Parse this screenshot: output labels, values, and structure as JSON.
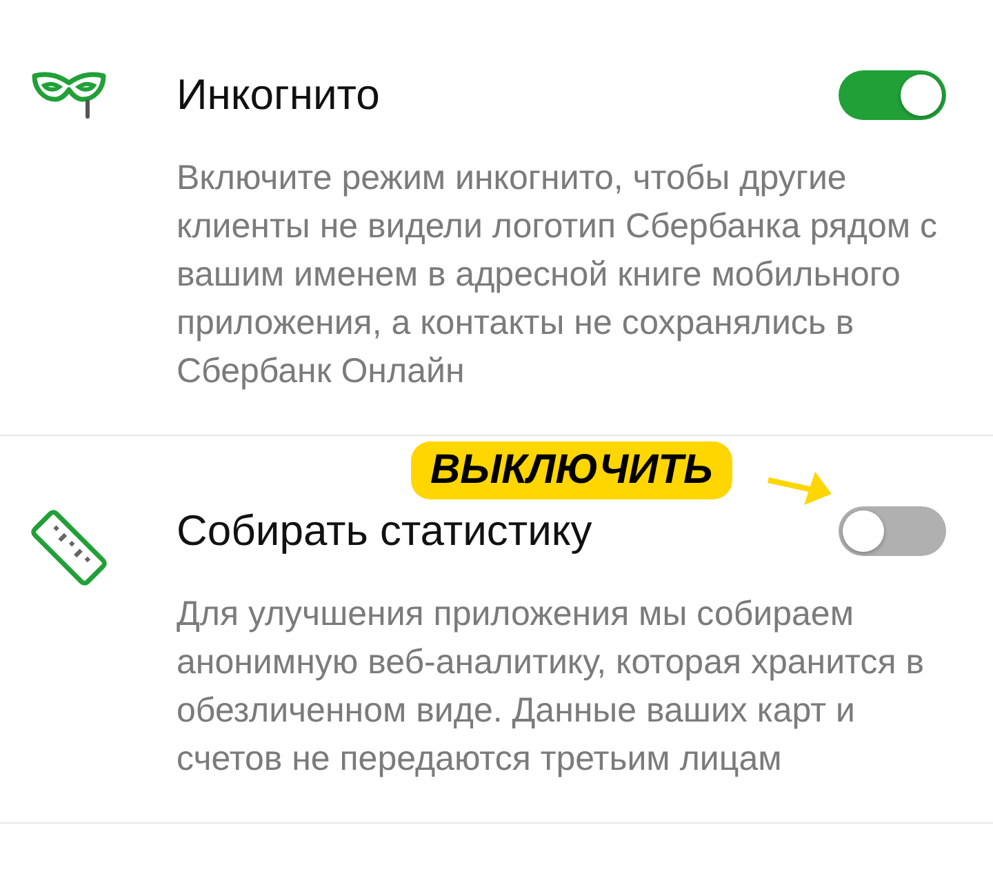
{
  "settings": [
    {
      "title": "Инкогнито",
      "on": true,
      "description": "Включите режим инкогнито, чтобы другие клиенты не видели логотип Сбербанка рядом с вашим именем в адресной книге мобильного приложения, а контакты не сохранялись в Сбербанк Онлайн"
    },
    {
      "title": "Собирать статистику",
      "on": false,
      "description": "Для улучшения приложения мы собираем анонимную веб-аналитику, которая хранится в обезличенном виде. Данные ваших карт и счетов не передаются третьим лицам",
      "callout": "ВЫКЛЮЧИТЬ"
    }
  ]
}
